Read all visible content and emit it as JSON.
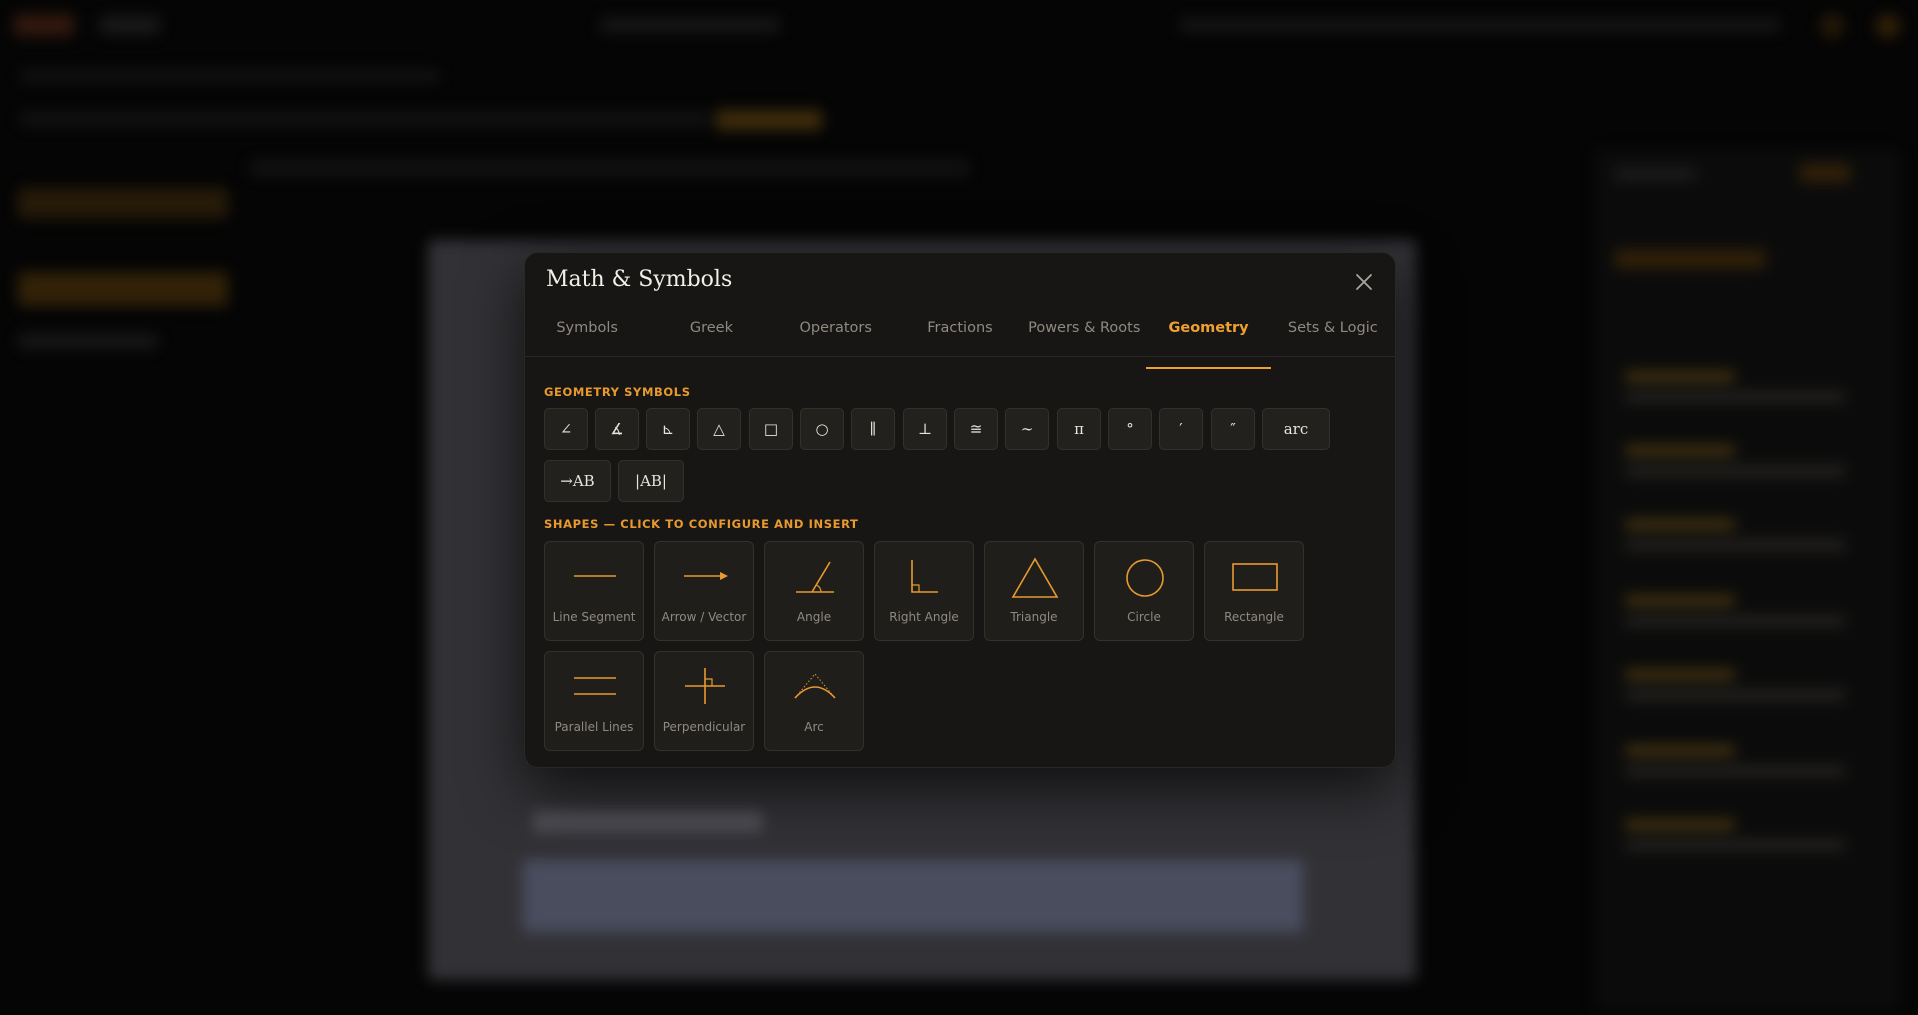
{
  "modal": {
    "title": "Math & Symbols",
    "close_icon": "close-icon"
  },
  "tabs": [
    {
      "label": "Symbols",
      "active": false
    },
    {
      "label": "Greek",
      "active": false
    },
    {
      "label": "Operators",
      "active": false
    },
    {
      "label": "Fractions",
      "active": false
    },
    {
      "label": "Powers & Roots",
      "active": false
    },
    {
      "label": "Geometry",
      "active": true
    },
    {
      "label": "Sets & Logic",
      "active": false
    }
  ],
  "geometry_symbols": {
    "title": "GEOMETRY SYMBOLS",
    "items": [
      "∠",
      "∡",
      "⊾",
      "△",
      "□",
      "○",
      "∥",
      "⊥",
      "≅",
      "∼",
      "π",
      "°",
      "′",
      "″",
      "arc",
      "→AB",
      "|AB|"
    ]
  },
  "shapes": {
    "title": "SHAPES — CLICK TO CONFIGURE AND INSERT",
    "items": [
      {
        "label": "Line Segment",
        "icon": "line-segment-icon"
      },
      {
        "label": "Arrow / Vector",
        "icon": "arrow-vector-icon"
      },
      {
        "label": "Angle",
        "icon": "angle-icon"
      },
      {
        "label": "Right Angle",
        "icon": "right-angle-icon"
      },
      {
        "label": "Triangle",
        "icon": "triangle-icon"
      },
      {
        "label": "Circle",
        "icon": "circle-icon"
      },
      {
        "label": "Rectangle",
        "icon": "rectangle-icon"
      },
      {
        "label": "Parallel Lines",
        "icon": "parallel-lines-icon"
      },
      {
        "label": "Perpendicular",
        "icon": "perpendicular-icon"
      },
      {
        "label": "Arc",
        "icon": "arc-icon"
      }
    ]
  },
  "colors": {
    "accent": "#f0a030",
    "modal_bg": "#171614",
    "button_bg": "#23211e"
  }
}
